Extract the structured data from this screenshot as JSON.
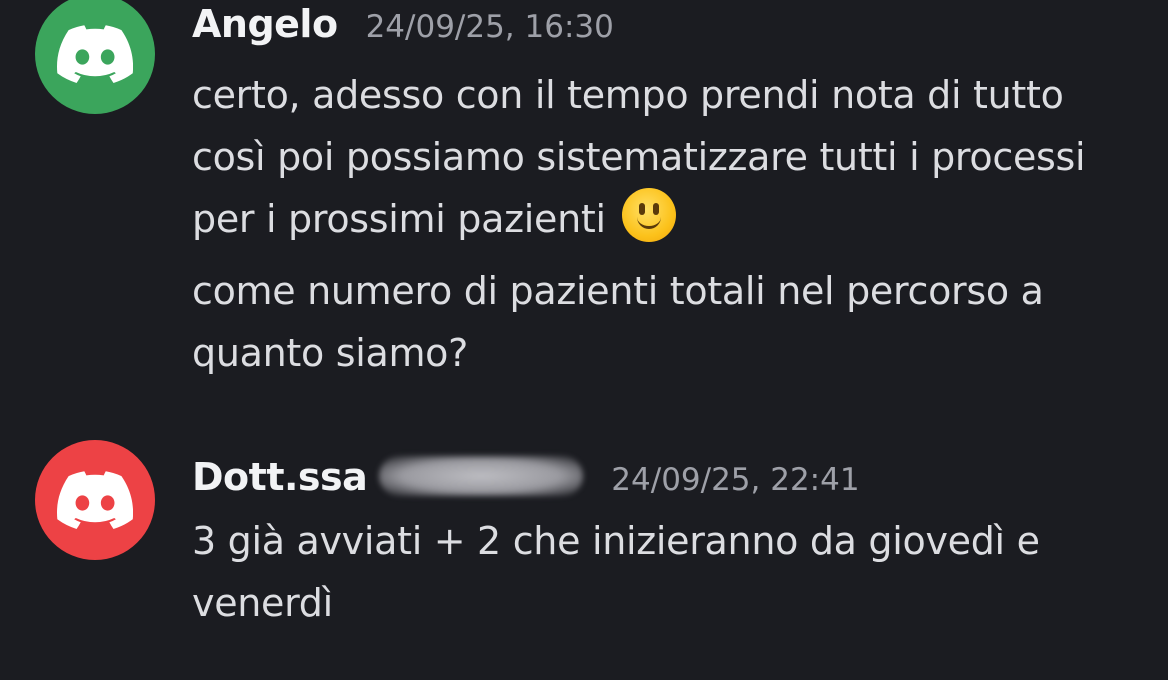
{
  "messages": [
    {
      "username": "Angelo",
      "timestamp": "24/09/25, 16:30",
      "avatar_color": "#3ba55c",
      "avatar_icon": "discord-logo-icon",
      "paragraphs": [
        {
          "text": "certo, adesso con il tempo prendi nota di tutto così poi possiamo sistematizzare tutti i processi per i prossimi pazienti",
          "emoji": "slightly-smiling-face-icon"
        },
        {
          "text": "come numero di pazienti totali nel percorso a quanto siamo?"
        }
      ]
    },
    {
      "username": "Dott.ssa",
      "username_redacted": true,
      "timestamp": "24/09/25, 22:41",
      "avatar_color": "#ed4245",
      "avatar_icon": "discord-logo-icon",
      "paragraphs": [
        {
          "text": "3 già avviati + 2 che inizieranno da giovedì e venerdì"
        }
      ]
    }
  ],
  "colors": {
    "background": "#1b1c21",
    "username": "#f2f3f5",
    "timestamp": "#9ea0a8",
    "message_text": "#dcdde1"
  }
}
